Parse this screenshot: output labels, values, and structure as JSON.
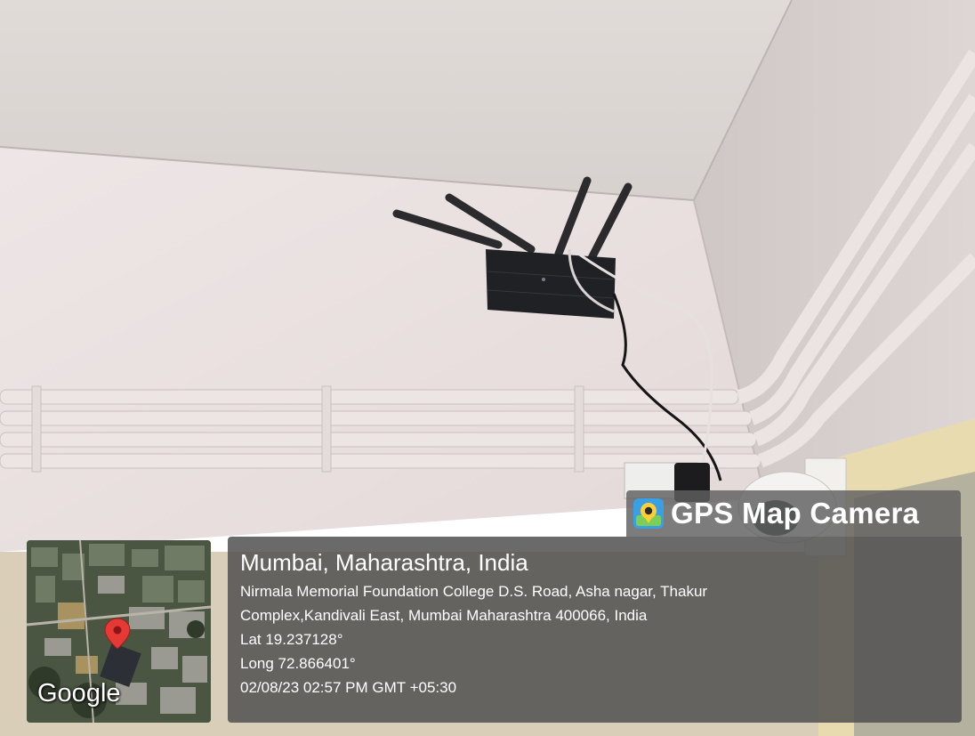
{
  "watermark": {
    "app_name": "GPS Map Camera",
    "icon": "gps-map-camera-app-icon"
  },
  "map": {
    "provider_label": "Google",
    "pin_icon": "map-pin-icon",
    "pin_color": "#e53935"
  },
  "location": {
    "city_line": "Mumbai, Maharashtra, India",
    "address_line_1": "Nirmala Memorial Foundation College D.S. Road, Asha nagar, Thakur",
    "address_line_2": "Complex,Kandivali East, Mumbai Maharashtra 400066, India",
    "latitude": "Lat 19.237128°",
    "longitude": "Long 72.866401°",
    "timestamp": "02/08/23 02:57 PM GMT +05:30"
  }
}
